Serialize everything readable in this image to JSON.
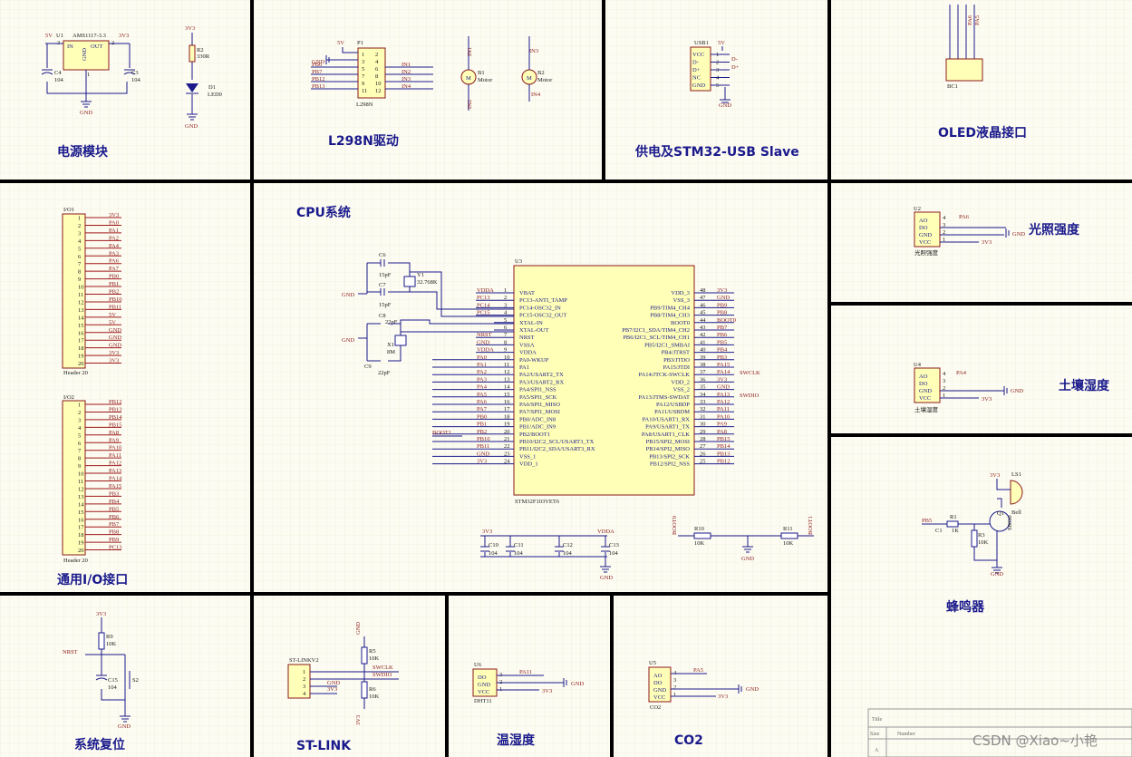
{
  "sections": {
    "power": "电源模块",
    "l298n": "L298N驱动",
    "usb": "供电及STM32-USB Slave",
    "oled": "OLED液晶接口",
    "cpu": "CPU系统",
    "light": "光照强度",
    "soil": "土壤湿度",
    "io": "通用I/O接口",
    "buzzer": "蜂鸣器",
    "reset": "系统复位",
    "stlink": "ST-LINK",
    "temp": "温湿度",
    "co2": "CO2"
  },
  "power": {
    "u1_ref": "U1",
    "u1_val": "AMS1117-3.3",
    "in": "IN",
    "out": "OUT",
    "gnd_pin": "GND",
    "v5": "5V",
    "v33": "3V3",
    "c4": "C4",
    "c4_val": "104",
    "c3": "C3",
    "c3_val": "104",
    "gnd": "GND",
    "r2": "R2",
    "r2_val": "330R",
    "d1": "D1",
    "d1_val": "LED0",
    "led_v": "3V3",
    "led_gnd": "GND",
    "pin3": "3",
    "pin2": "2",
    "pin1": "1"
  },
  "l298n": {
    "p1": "P1",
    "p1_val": "L298N",
    "v5": "5V",
    "gnd": "GND",
    "left_nets": [
      "PB6",
      "PB7",
      "PB12",
      "PB13"
    ],
    "right_nets": [
      "IN1",
      "IN2",
      "IN3",
      "IN4"
    ],
    "left_pins": [
      "1",
      "3",
      "5",
      "7",
      "9",
      "11"
    ],
    "right_pins": [
      "2",
      "4",
      "6",
      "8",
      "10",
      "12"
    ],
    "b1": "B1",
    "b1_val": "Motor",
    "b2": "B2",
    "b2_val": "Motor",
    "in1": "IN1",
    "in2": "IN2",
    "in3": "IN3",
    "in4": "IN4"
  },
  "usb": {
    "ref": "USB1",
    "v5": "5V",
    "pins": [
      "VCC",
      "D-",
      "D+",
      "NC",
      "GND"
    ],
    "nums": [
      "1",
      "2",
      "3",
      "4",
      "5"
    ],
    "dm": "D-",
    "dp": "D+",
    "gnd": "GND"
  },
  "oled": {
    "ref": "BC1",
    "nets": [
      "PA6",
      "PA5"
    ]
  },
  "cpu": {
    "u3": "U3",
    "u3_val": "STM32F103VET6",
    "c6": "C6",
    "c6_val": "15pF",
    "c7": "C7",
    "c7_val": "15pF",
    "y1": "Y1",
    "y1_val": "32.768K",
    "c8": "C8",
    "c8_val": "22pF",
    "c9": "C9",
    "c9_val": "22pF",
    "x1": "X1",
    "x1_val": "8M",
    "gnd": "GND",
    "boot1": "BOOT1",
    "left_pins": [
      {
        "net": "VDDA",
        "num": "1",
        "name": "VBAT"
      },
      {
        "net": "PC13",
        "num": "2",
        "name": "PC13-ANTI_TAMP"
      },
      {
        "net": "PC14",
        "num": "3",
        "name": "PC14-OSC32_IN"
      },
      {
        "net": "PC15",
        "num": "4",
        "name": "PC15-OSC32_OUT"
      },
      {
        "net": "",
        "num": "5",
        "name": "XTAL-IN"
      },
      {
        "net": "",
        "num": "6",
        "name": "XTAL-OUT"
      },
      {
        "net": "NRST",
        "num": "7",
        "name": "NRST"
      },
      {
        "net": "GND",
        "num": "8",
        "name": "VSSA"
      },
      {
        "net": "VDDA",
        "num": "9",
        "name": "VDDA"
      },
      {
        "net": "PA0",
        "num": "10",
        "name": "PA0-WKUP"
      },
      {
        "net": "PA1",
        "num": "11",
        "name": "PA1"
      },
      {
        "net": "PA2",
        "num": "12",
        "name": "PA2/USART2_TX"
      },
      {
        "net": "PA3",
        "num": "13",
        "name": "PA3/USART2_RX"
      },
      {
        "net": "PA4",
        "num": "14",
        "name": "PA4/SPI1_NSS"
      },
      {
        "net": "PA5",
        "num": "15",
        "name": "PA5/SPI1_SCK"
      },
      {
        "net": "PA6",
        "num": "16",
        "name": "PA6/SPI1_MISO"
      },
      {
        "net": "PA7",
        "num": "17",
        "name": "PA7/SPI1_MOSI"
      },
      {
        "net": "PB0",
        "num": "18",
        "name": "PB0/ADC_IN8"
      },
      {
        "net": "PB1",
        "num": "19",
        "name": "PB1/ADC_IN9"
      },
      {
        "net": "PB2",
        "num": "20",
        "name": "PB2/BOOT1"
      },
      {
        "net": "PB10",
        "num": "21",
        "name": "PB10/I2C2_SCL/USART3_TX"
      },
      {
        "net": "PB11",
        "num": "22",
        "name": "PB11/I2C2_SDA/USART3_RX"
      },
      {
        "net": "GND",
        "num": "23",
        "name": "VSS_1"
      },
      {
        "net": "3V3",
        "num": "24",
        "name": "VDD_1"
      }
    ],
    "right_pins": [
      {
        "net": "3V3",
        "num": "48",
        "name": "VDD_3"
      },
      {
        "net": "GND",
        "num": "47",
        "name": "VSS_3"
      },
      {
        "net": "PB9",
        "num": "46",
        "name": "PB9/TIM4_CH4"
      },
      {
        "net": "PB8",
        "num": "45",
        "name": "PB8/TIM4_CH3"
      },
      {
        "net": "BOOT0",
        "num": "44",
        "name": "BOOT0"
      },
      {
        "net": "PB7",
        "num": "43",
        "name": "PB7/I2C1_SDA/TIM4_CH2"
      },
      {
        "net": "PB6",
        "num": "42",
        "name": "PB6/I2C1_SCL/TIM4_CH1"
      },
      {
        "net": "PB5",
        "num": "41",
        "name": "PB5/I2C1_SMBAI"
      },
      {
        "net": "PB4",
        "num": "40",
        "name": "PB4/JTRST"
      },
      {
        "net": "PB3",
        "num": "39",
        "name": "PB3/JTDO"
      },
      {
        "net": "PA15",
        "num": "38",
        "name": "PA15/JTDI"
      },
      {
        "net": "PA14",
        "num": "37",
        "name": "PA14/JTCK-SWCLK"
      },
      {
        "net": "3V3",
        "num": "36",
        "name": "VDD_2"
      },
      {
        "net": "GND",
        "num": "35",
        "name": "VSS_2"
      },
      {
        "net": "PA13",
        "num": "34",
        "name": "PA13/JTMS-SWDAT"
      },
      {
        "net": "PA12",
        "num": "33",
        "name": "PA12/USBDP"
      },
      {
        "net": "PA11",
        "num": "32",
        "name": "PA11/USBDM"
      },
      {
        "net": "PA10",
        "num": "31",
        "name": "PA10/USART1_RX"
      },
      {
        "net": "PA9",
        "num": "30",
        "name": "PA9/USART1_TX"
      },
      {
        "net": "PA8",
        "num": "29",
        "name": "PA8/USART1_CLK"
      },
      {
        "net": "PB15",
        "num": "28",
        "name": "PB15/SPI2_MOSI"
      },
      {
        "net": "PB14",
        "num": "27",
        "name": "PB14/SPI2_MISO"
      },
      {
        "net": "PB13",
        "num": "26",
        "name": "PB13/SPI2_SCK"
      },
      {
        "net": "PB12",
        "num": "25",
        "name": "PB12/SPI2_NSS"
      }
    ],
    "swclk": "SWCLK",
    "swdio": "SWDIO",
    "v33": "3V3",
    "vdda": "VDDA",
    "caps": [
      {
        "ref": "C10",
        "val": "104"
      },
      {
        "ref": "C11",
        "val": "104"
      },
      {
        "ref": "C12",
        "val": "104"
      },
      {
        "ref": "C13",
        "val": "104"
      }
    ],
    "boot0": "BOOT0",
    "r10": "R10",
    "r10_val": "10K",
    "r11": "R11",
    "r11_val": "10K"
  },
  "io1": {
    "ref": "I/O1",
    "val": "Header 20",
    "nets": [
      "3V3",
      "PA0",
      "PA1",
      "PA2",
      "PA4",
      "PA3",
      "PA6",
      "PA7",
      "PB0",
      "PB1",
      "PB2",
      "PB10",
      "PB11",
      "5V",
      "5V",
      "GND",
      "GND",
      "GND",
      "3V3",
      "3V3"
    ]
  },
  "io2": {
    "ref": "I/O2",
    "val": "Header 20",
    "nets": [
      "PB12",
      "PB13",
      "PB14",
      "PB15",
      "PA8",
      "PA9",
      "PA10",
      "PA11",
      "PA12",
      "PA13",
      "PA14",
      "PA15",
      "PB3",
      "PB4",
      "PB5",
      "PB6",
      "PB7",
      "PB8",
      "PB9",
      "PC13"
    ]
  },
  "light": {
    "ref": "U2",
    "pins": [
      "AO",
      "DO",
      "GND",
      "VCC"
    ],
    "nums": [
      "4",
      "3",
      "2",
      "1"
    ],
    "net": "PA6",
    "gnd": "GND",
    "v33": "3V3",
    "sub": "光照强度"
  },
  "soil": {
    "ref": "U4",
    "pins": [
      "AO",
      "DO",
      "GND",
      "VCC"
    ],
    "nums": [
      "4",
      "3",
      "2",
      "1"
    ],
    "net": "PA4",
    "gnd": "GND",
    "v33": "3V3",
    "sub": "土壤湿度"
  },
  "buzzer": {
    "v33": "3V3",
    "ls": "LS1",
    "q1": "Q1",
    "q1_val": "S8050",
    "bell": "Bell",
    "pb5": "PB5",
    "r1": "R1",
    "r1_val": "1K",
    "r3": "R3",
    "r3_val": "10K",
    "c1": "C1",
    "gnd": "GND"
  },
  "reset": {
    "v33": "3V3",
    "r9": "R9",
    "r9_val": "10K",
    "nrst": "NRST",
    "c15": "C15",
    "c15_val": "104",
    "s2": "S2",
    "gnd": "GND"
  },
  "stlink": {
    "ref": "ST-LINKV2",
    "nums": [
      "1",
      "2",
      "3",
      "4"
    ],
    "gnd_top": "GND",
    "r5": "R5",
    "r5_val": "10K",
    "r6": "R6",
    "r6_val": "10K",
    "swclk": "SWCLK",
    "swdio": "SWDIO",
    "gnd": "GND",
    "v33": "3V3",
    "v33_bot": "3V3"
  },
  "temp": {
    "ref": "U6",
    "pins": [
      "DO",
      "GND",
      "VCC"
    ],
    "nums": [
      "3",
      "2",
      "1"
    ],
    "net": "PA11",
    "gnd": "GND",
    "v33": "3V3",
    "val": "DHT11"
  },
  "co2": {
    "ref": "U5",
    "pins": [
      "AO",
      "DO",
      "GND",
      "VCC"
    ],
    "nums": [
      "4",
      "3",
      "2",
      "1"
    ],
    "net": "PA5",
    "gnd": "GND",
    "v33": "3V3",
    "val": "CO2"
  },
  "titleblock": {
    "title": "Title",
    "size": "Size",
    "number": "Number",
    "a": "A"
  },
  "watermark": "CSDN @Xiao~小艳"
}
